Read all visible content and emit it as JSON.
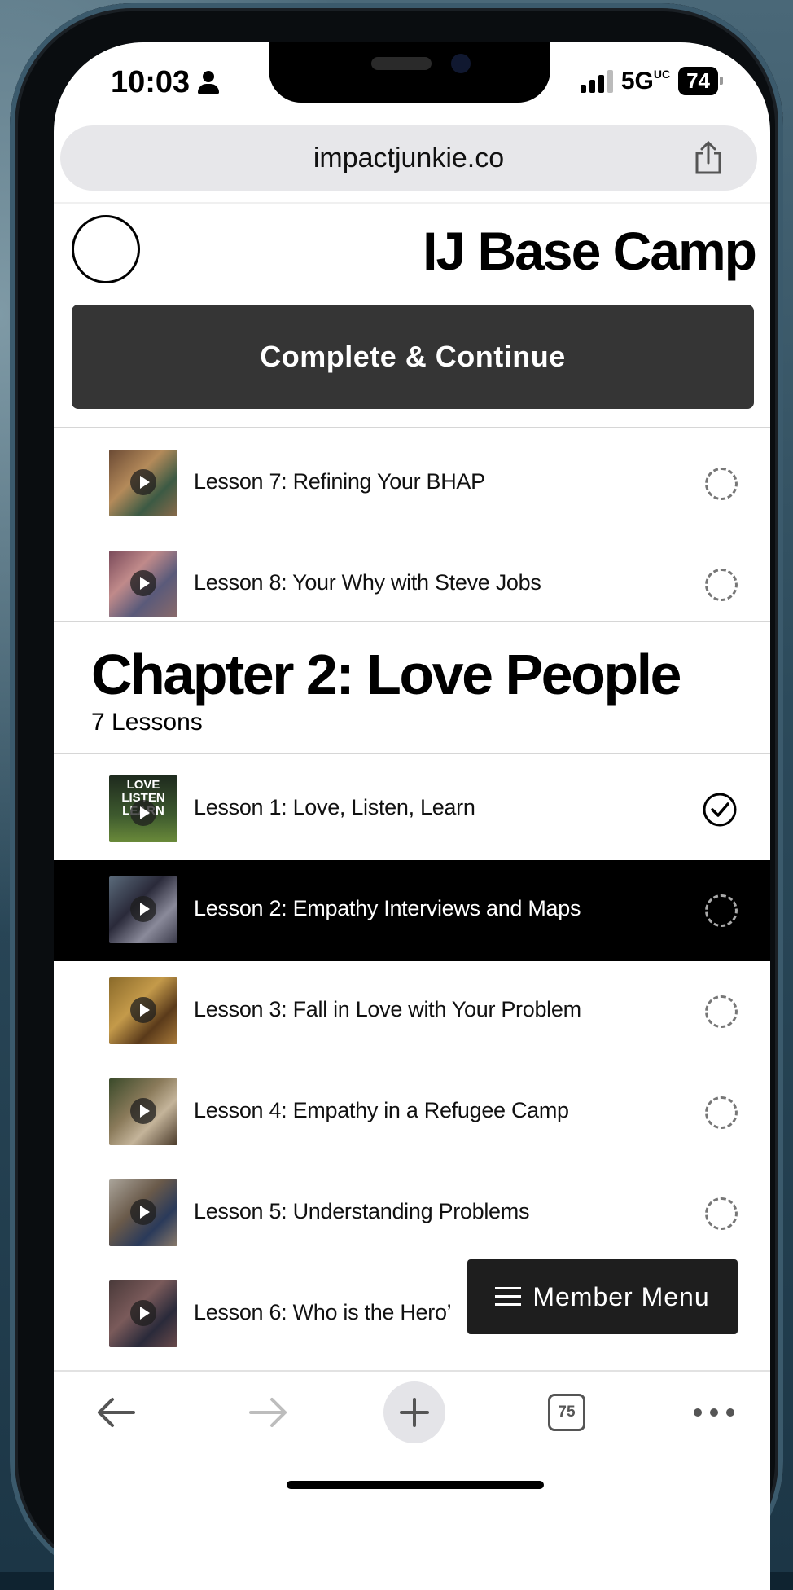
{
  "status_bar": {
    "time": "10:03",
    "network": "5G",
    "network_suffix": "UC",
    "battery": "74"
  },
  "browser": {
    "url": "impactjunkie.co",
    "tab_count": "75"
  },
  "header": {
    "title": "IJ Base Camp",
    "complete_label": "Complete & Continue"
  },
  "chapter1_tail": [
    {
      "title": "Lesson 7: Refining Your BHAP",
      "status": "incomplete"
    },
    {
      "title": "Lesson 8: Your Why with Steve Jobs",
      "status": "incomplete"
    }
  ],
  "chapter2": {
    "title": "Chapter 2: Love People",
    "count": "7 Lessons",
    "lessons": [
      {
        "title": "Lesson 1: Love, Listen, Learn",
        "status": "complete",
        "thumb_text": "LOVE LISTEN LEARN"
      },
      {
        "title": "Lesson 2: Empathy Interviews and Maps",
        "status": "incomplete",
        "active": true
      },
      {
        "title": "Lesson 3: Fall in Love with Your Problem",
        "status": "incomplete"
      },
      {
        "title": "Lesson 4: Empathy in a Refugee Camp",
        "status": "incomplete"
      },
      {
        "title": "Lesson 5: Understanding Problems",
        "status": "incomplete"
      },
      {
        "title": "Lesson 6: Who is the Hero’",
        "status": "incomplete"
      }
    ]
  },
  "member_menu": {
    "label": "Member Menu"
  },
  "colors": {
    "active_row": "#000000",
    "button": "#353535",
    "menu": "#1e1e1e"
  }
}
